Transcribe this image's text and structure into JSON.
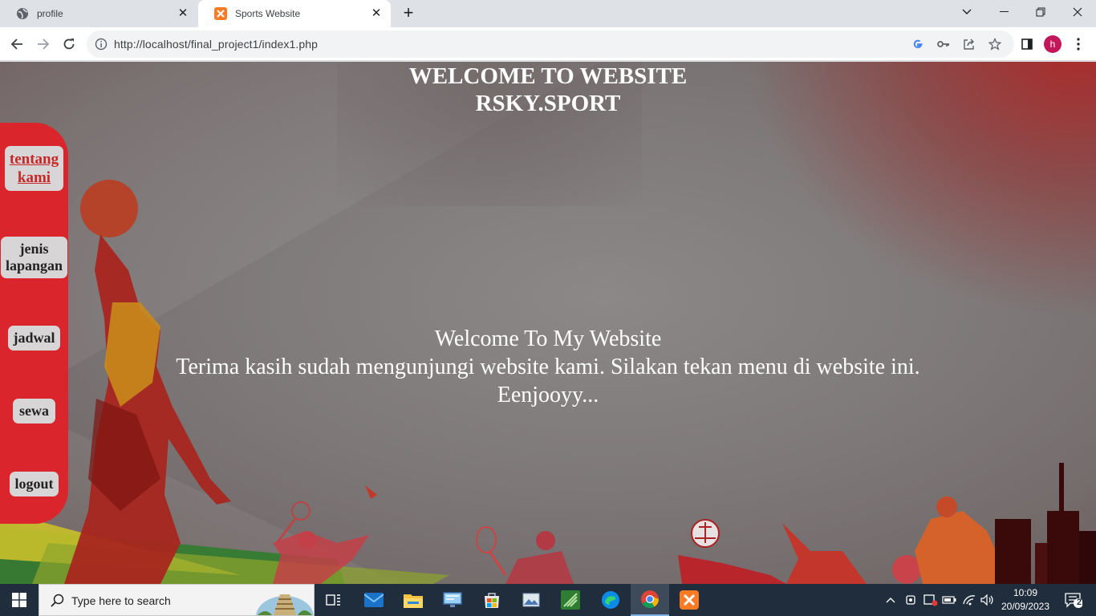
{
  "browser": {
    "tabs": [
      {
        "title": "profile",
        "icon": "globe-icon"
      },
      {
        "title": "Sports Website",
        "icon": "xampp-icon"
      }
    ],
    "url": "http://localhost/final_project1/index1.php",
    "profile_initial": "h"
  },
  "page": {
    "heading_line1": "WELCOME TO WEBSITE",
    "heading_line2": "RSKY.SPORT",
    "welcome_line1": "Welcome To My Website",
    "welcome_line2": "Terima kasih sudah mengunjungi website kami. Silakan tekan menu di website ini.",
    "welcome_line3": "Eenjooyy...",
    "menu": [
      {
        "line1": "tentang",
        "line2": "kami"
      },
      {
        "line1": "jenis",
        "line2": "lapangan"
      },
      {
        "line1": "jadwal"
      },
      {
        "line1": "sewa"
      },
      {
        "line1": "logout"
      }
    ],
    "colors": {
      "sidebar": "#d9252b",
      "menu_button": "#d7d5d5",
      "active_link": "#c62828"
    }
  },
  "taskbar": {
    "search_placeholder": "Type here to search",
    "time": "10:09",
    "date": "20/09/2023",
    "notification_count": "2"
  }
}
